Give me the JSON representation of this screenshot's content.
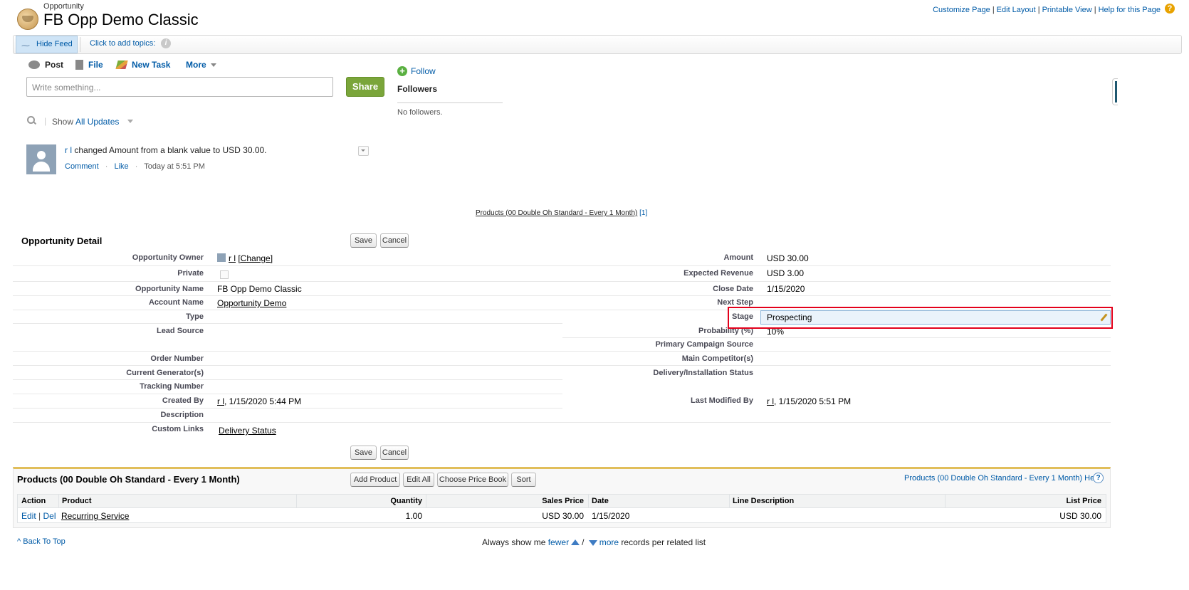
{
  "header": {
    "object_type": "Opportunity",
    "title": "FB Opp Demo Classic",
    "links": [
      "Customize Page",
      "Edit Layout",
      "Printable View",
      "Help for this Page"
    ],
    "help_icon": "question-icon"
  },
  "feedbar": {
    "hide_feed": "Hide Feed",
    "topics": "Click to add topics:",
    "info_icon": "info-icon"
  },
  "publisher": {
    "tabs": [
      "Post",
      "File",
      "New Task",
      "More"
    ],
    "placeholder": "Write something...",
    "share": "Share"
  },
  "followers": {
    "follow": "Follow",
    "title": "Followers",
    "empty": "No followers."
  },
  "feed_filter": {
    "show": "Show",
    "selected": "All Updates"
  },
  "feed_item": {
    "user": "r l",
    "text": "changed Amount from a blank value to USD 30.00.",
    "comment": "Comment",
    "like": "Like",
    "time": "Today at 5:51 PM"
  },
  "related_link": {
    "text": "Products (00 Double Oh Standard - Every 1 Month)",
    "count": "[1]"
  },
  "detail": {
    "title": "Opportunity Detail",
    "save": "Save",
    "cancel": "Cancel",
    "left": [
      {
        "label": "Opportunity Owner",
        "value": "r l",
        "extra": "[Change]"
      },
      {
        "label": "Private",
        "value": ""
      },
      {
        "label": "Opportunity Name",
        "value": "FB Opp Demo Classic"
      },
      {
        "label": "Account Name",
        "value": "Opportunity Demo"
      },
      {
        "label": "Type",
        "value": ""
      },
      {
        "label": "Lead Source",
        "value": ""
      },
      {
        "label": "Order Number",
        "value": ""
      },
      {
        "label": "Current Generator(s)",
        "value": ""
      },
      {
        "label": "Tracking Number",
        "value": ""
      },
      {
        "label": "Created By",
        "value": "r l",
        "extra": ", 1/15/2020 5:44 PM"
      },
      {
        "label": "Description",
        "value": ""
      },
      {
        "label": "Custom Links",
        "value": "Delivery Status"
      }
    ],
    "right": [
      {
        "label": "Amount",
        "value": "USD 30.00"
      },
      {
        "label": "Expected Revenue",
        "value": "USD 3.00"
      },
      {
        "label": "Close Date",
        "value": "1/15/2020"
      },
      {
        "label": "Next Step",
        "value": ""
      },
      {
        "label": "Stage",
        "value": "Prospecting"
      },
      {
        "label": "Probability (%)",
        "value": "10%"
      },
      {
        "label": "Primary Campaign Source",
        "value": ""
      },
      {
        "label": "Main Competitor(s)",
        "value": ""
      },
      {
        "label": "Delivery/Installation Status",
        "value": ""
      },
      {
        "label": "Last Modified By",
        "value": "r l",
        "extra": ", 1/15/2020 5:51 PM"
      }
    ]
  },
  "products": {
    "title": "Products (00 Double Oh Standard - Every 1 Month)",
    "buttons": [
      "Add Product",
      "Edit All",
      "Choose Price Book",
      "Sort"
    ],
    "help": "Products (00 Double Oh Standard - Every 1 Month) Help",
    "columns": [
      "Action",
      "Product",
      "Quantity",
      "Sales Price",
      "Date",
      "Line Description",
      "List Price"
    ],
    "rows": [
      {
        "edit": "Edit",
        "del": "Del",
        "product": "Recurring Service",
        "quantity": "1.00",
        "sales_price": "USD 30.00",
        "date": "1/15/2020",
        "line_description": "",
        "list_price": "USD 30.00"
      }
    ]
  },
  "footer": {
    "back_to_top": "Back To Top",
    "always_show": "Always show me",
    "fewer": "fewer",
    "more": "more",
    "suffix": "records per related list"
  },
  "colors": {
    "link": "#015ba7",
    "share_green": "#7aa53a",
    "highlight_red": "#e3001b",
    "products_accent": "#e1be5a"
  }
}
